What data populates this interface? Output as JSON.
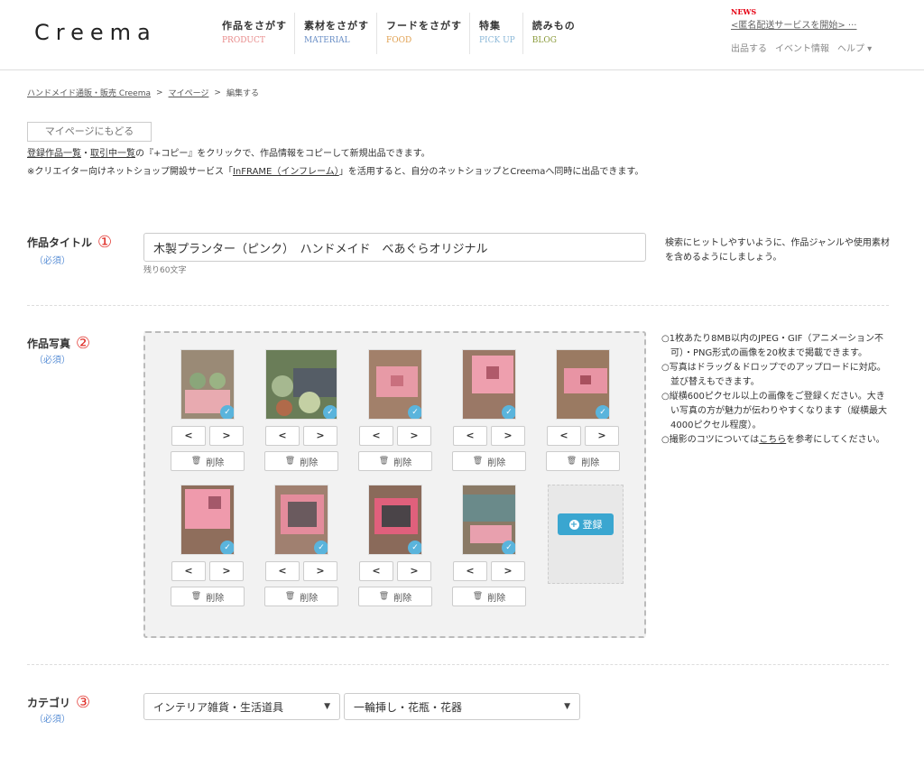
{
  "header": {
    "logo": "Creema",
    "nav": [
      {
        "jp": "作品をさがす",
        "en": "PRODUCT",
        "color": "#e88a8a"
      },
      {
        "jp": "素材をさがす",
        "en": "MATERIAL",
        "color": "#6a8fc6"
      },
      {
        "jp": "フードをさがす",
        "en": "FOOD",
        "color": "#e0a050"
      },
      {
        "jp": "特集",
        "en": "PICK UP",
        "color": "#8bb8d8"
      },
      {
        "jp": "読みもの",
        "en": "BLOG",
        "color": "#8a9a3a"
      }
    ],
    "news_label": "NEWS",
    "news_text": "<匿名配送サービスを開始> ···",
    "subnav": [
      "出品する",
      "イベント情報",
      "ヘルプ ▾"
    ]
  },
  "breadcrumb": {
    "items": [
      "ハンドメイド通販・販売 Creema",
      "マイページ",
      "編集する"
    ],
    "separator": ">"
  },
  "back_button": "マイページにもどる",
  "intro": {
    "line1_link1": "登録作品一覧",
    "line1_sep": "・",
    "line1_link2": "取引中一覧",
    "line1_rest": "の『+コピー』をクリックで、作品情報をコピーして新規出品できます。",
    "line2_pre": "※クリエイター向けネットショップ開設サービス「",
    "line2_link": "InFRAME（インフレーム）",
    "line2_post": "」を活用すると、自分のネットショップとCreemaへ同時に出品できます。"
  },
  "title_field": {
    "label": "作品タイトル",
    "number": "①",
    "required": "（必須）",
    "value": "木製プランター（ピンク）　ハンドメイド　べあぐらオリジナル",
    "remaining": "残り60文字",
    "hint": "検索にヒットしやすいように、作品ジャンルや使用素材を含めるようにしましょう。"
  },
  "photo_field": {
    "label": "作品写真",
    "number": "②",
    "required": "（必須）",
    "prev": "<",
    "next": ">",
    "delete": "削除",
    "check": "✓",
    "upload": "登録",
    "photos": [
      {
        "bg": "#9a8a76",
        "accent": "#e8aab0"
      },
      {
        "bg": "#6a7d58",
        "accent": "#555d66"
      },
      {
        "bg": "#a2806a",
        "accent": "#e79aa6"
      },
      {
        "bg": "#9a7866",
        "accent": "#ee9fae"
      },
      {
        "bg": "#9a7a62",
        "accent": "#e894a4"
      },
      {
        "bg": "#8f6e5c",
        "accent": "#ef9aac"
      },
      {
        "bg": "#a08070",
        "accent": "#e48c9c"
      },
      {
        "bg": "#8a6a5a",
        "accent": "#e0607c"
      },
      {
        "bg": "#8a7a66",
        "accent": "#6a8a8a"
      }
    ],
    "hints": [
      "○1枚あたり8MB以内のJPEG・GIF（アニメーション不可）・PNG形式の画像を20枚まで掲載できます。",
      "○写真はドラッグ＆ドロップでのアップロードに対応。並び替えもできます。",
      "○縦横600ピクセル以上の画像をご登録ください。大きい写真の方が魅力が伝わりやすくなります（縦横最大4000ピクセル程度）。"
    ],
    "hint4_pre": "○撮影のコツについては",
    "hint4_link": "こちら",
    "hint4_post": "を参考にしてください。"
  },
  "category_field": {
    "label": "カテゴリ",
    "number": "③",
    "required": "（必須）",
    "select1": "インテリア雑貨・生活道具",
    "select2": "一輪挿し・花瓶・花器"
  }
}
